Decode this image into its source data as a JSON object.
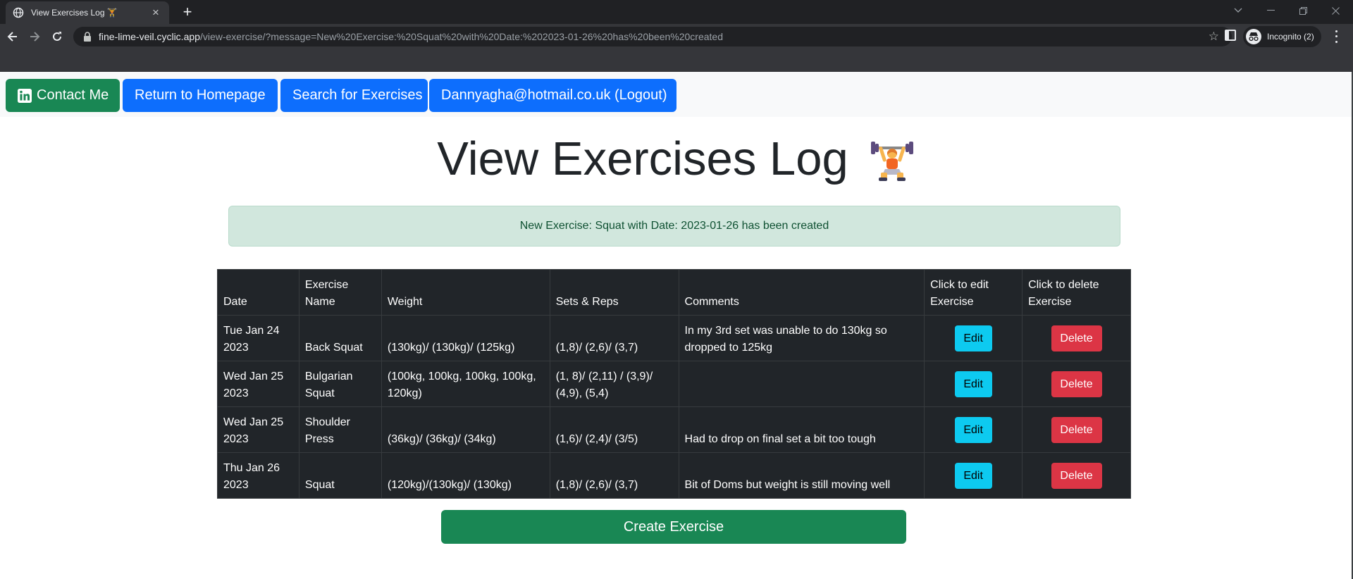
{
  "browser": {
    "tab_title": "View Exercises Log 🏋️",
    "url_host": "fine-lime-veil.cyclic.app",
    "url_path": "/view-exercise/?message=New%20Exercise:%20Squat%20with%20Date:%202023-01-26%20has%20been%20created",
    "profile_label": "Incognito (2)"
  },
  "navbar": {
    "contact_label": "Contact Me",
    "home_label": "Return to Homepage",
    "search_label": "Search for Exercises",
    "logout_label": "Dannyagha@hotmail.co.uk (Logout)"
  },
  "page": {
    "title": "View Exercises Log",
    "alert_message": "New Exercise: Squat with Date: 2023-01-26 has been created",
    "create_label": "Create Exercise"
  },
  "table": {
    "headers": {
      "date": "Date",
      "name": "Exercise Name",
      "weight": "Weight",
      "sets_reps": "Sets & Reps",
      "comments": "Comments",
      "edit": "Click to edit Exercise",
      "delete": "Click to delete Exercise"
    },
    "edit_label": "Edit",
    "delete_label": "Delete",
    "rows": [
      {
        "date": "Tue Jan 24 2023",
        "name": "Back Squat",
        "weight": "(130kg)/ (130kg)/ (125kg)",
        "sets_reps": "(1,8)/ (2,6)/ (3,7)",
        "comments": "In my 3rd set was unable to do 130kg so dropped to 125kg"
      },
      {
        "date": "Wed Jan 25 2023",
        "name": "Bulgarian Squat",
        "weight": "(100kg, 100kg, 100kg, 100kg, 120kg)",
        "sets_reps": "(1, 8)/ (2,11) / (3,9)/ (4,9), (5,4)",
        "comments": ""
      },
      {
        "date": "Wed Jan 25 2023",
        "name": "Shoulder Press",
        "weight": "(36kg)/ (36kg)/ (34kg)",
        "sets_reps": "(1,6)/ (2,4)/ (3/5)",
        "comments": "Had to drop on final set a bit too tough"
      },
      {
        "date": "Thu Jan 26 2023",
        "name": "Squat",
        "weight": "(120kg)/(130kg)/ (130kg)",
        "sets_reps": "(1,8)/ (2,6)/ (3,7)",
        "comments": "Bit of Doms but weight is still moving well"
      }
    ]
  },
  "colors": {
    "success": "#198754",
    "primary": "#0d6efd",
    "info": "#0dcaf0",
    "danger": "#dc3545",
    "table_dark": "#212529",
    "alert_bg": "#d1e7dd"
  }
}
